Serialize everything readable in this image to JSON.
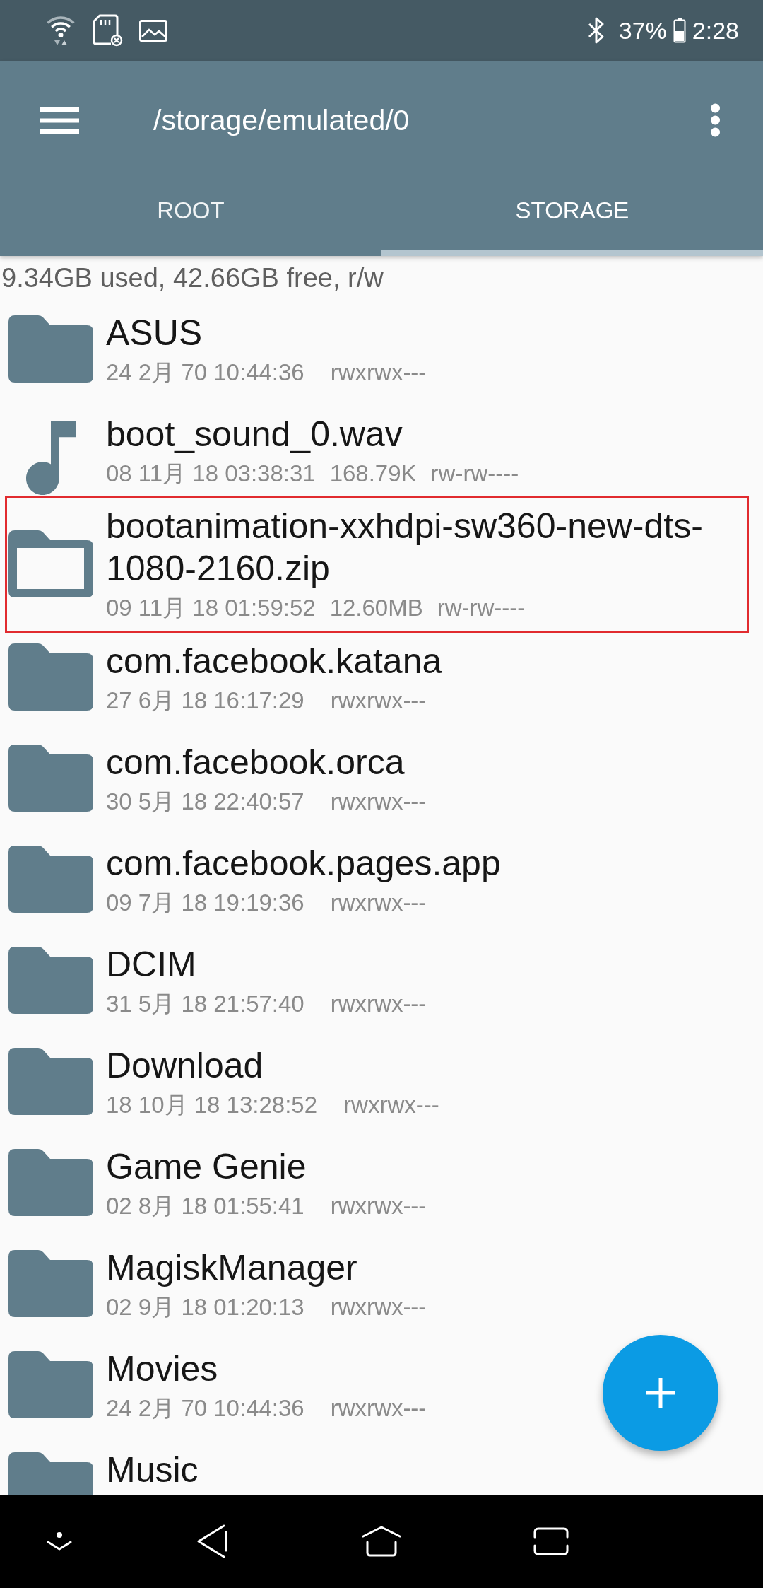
{
  "status_bar": {
    "battery": "37%",
    "time": "2:28"
  },
  "toolbar": {
    "path": "/storage/emulated/0"
  },
  "tabs": [
    {
      "label": "ROOT",
      "selected": false
    },
    {
      "label": "STORAGE",
      "selected": true
    }
  ],
  "storage_info": "9.34GB used, 42.66GB free, r/w",
  "files": [
    {
      "kind": "folder",
      "name": "ASUS",
      "date": "24 2月 70 10:44:36",
      "permissions": "rwxrwx---",
      "highlighted": false
    },
    {
      "kind": "audio",
      "name": "boot_sound_0.wav",
      "date": "08 11月 18 03:38:31",
      "size": "168.79K",
      "permissions": "rw-rw----",
      "highlighted": false
    },
    {
      "kind": "archive",
      "name": "bootanimation-xxhdpi-sw360-new-dts-1080-2160.zip",
      "date": "09 11月 18 01:59:52",
      "size": "12.60MB",
      "permissions": "rw-rw----",
      "highlighted": true
    },
    {
      "kind": "folder",
      "name": "com.facebook.katana",
      "date": "27 6月 18 16:17:29",
      "permissions": "rwxrwx---",
      "highlighted": false
    },
    {
      "kind": "folder",
      "name": "com.facebook.orca",
      "date": "30 5月 18 22:40:57",
      "permissions": "rwxrwx---",
      "highlighted": false
    },
    {
      "kind": "folder",
      "name": "com.facebook.pages.app",
      "date": "09 7月 18 19:19:36",
      "permissions": "rwxrwx---",
      "highlighted": false
    },
    {
      "kind": "folder",
      "name": "DCIM",
      "date": "31 5月 18 21:57:40",
      "permissions": "rwxrwx---",
      "highlighted": false
    },
    {
      "kind": "folder",
      "name": "Download",
      "date": "18 10月 18 13:28:52",
      "permissions": "rwxrwx---",
      "highlighted": false
    },
    {
      "kind": "folder",
      "name": "Game Genie",
      "date": "02 8月 18 01:55:41",
      "permissions": "rwxrwx---",
      "highlighted": false
    },
    {
      "kind": "folder",
      "name": "MagiskManager",
      "date": "02 9月 18 01:20:13",
      "permissions": "rwxrwx---",
      "highlighted": false
    },
    {
      "kind": "folder",
      "name": "Movies",
      "date": "24 2月 70 10:44:36",
      "permissions": "rwxrwx---",
      "highlighted": false
    },
    {
      "kind": "folder",
      "name": "Music",
      "highlighted": false
    }
  ]
}
